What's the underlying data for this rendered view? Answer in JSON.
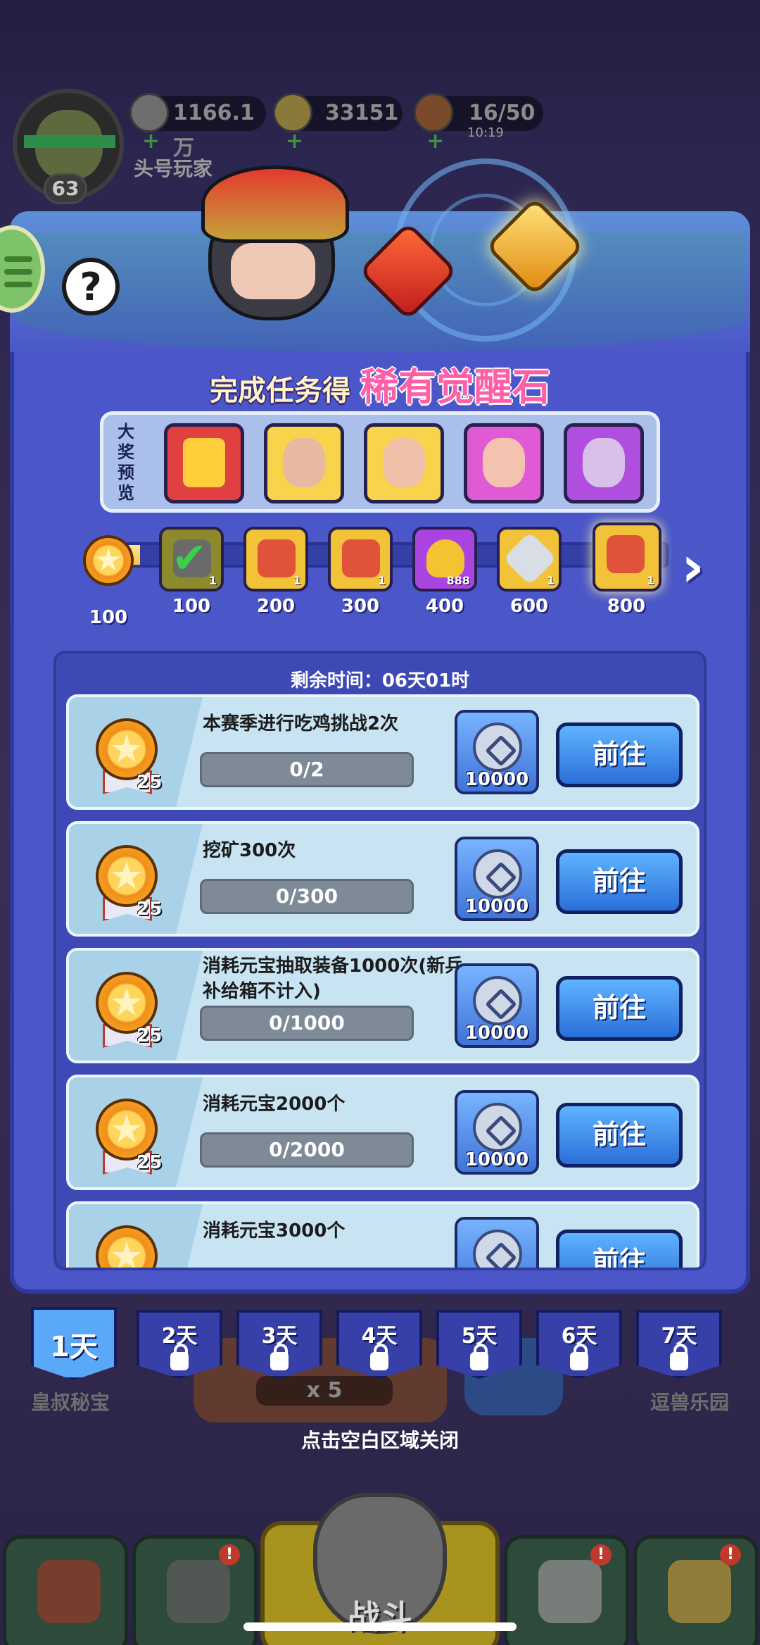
{
  "status": {
    "level": "63",
    "player_name": "头号玩家",
    "copper": "1166.1万",
    "gold": "33151",
    "stamina": "16/50",
    "stamina_timer": "10:19"
  },
  "headline": {
    "prefix": "完成任务得",
    "highlight": "稀有觉醒石"
  },
  "preview": {
    "label": "大奖预览",
    "items": [
      "red-puzzle",
      "hero-1",
      "hero-2",
      "hero-3",
      "hero-4"
    ]
  },
  "progress": {
    "current_points": "100",
    "fill_fraction": 0.08,
    "milestones": [
      {
        "points": "100",
        "count": "1",
        "claimed": true
      },
      {
        "points": "200",
        "count": "1",
        "claimed": false
      },
      {
        "points": "300",
        "count": "1",
        "claimed": false
      },
      {
        "points": "400",
        "count": "888",
        "claimed": false
      },
      {
        "points": "600",
        "count": "1",
        "claimed": false
      },
      {
        "points": "800",
        "count": "1",
        "claimed": false
      }
    ]
  },
  "tasks": {
    "remaining_time": "剩余时间：06天01时",
    "go_label": "前往",
    "items": [
      {
        "title": "本赛季进行吃鸡挑战2次",
        "progress": "0/2",
        "points": "25",
        "reward": "10000"
      },
      {
        "title": "挖矿300次",
        "progress": "0/300",
        "points": "25",
        "reward": "10000"
      },
      {
        "title": "消耗元宝抽取装备1000次(新兵补给箱不计入)",
        "progress": "0/1000",
        "points": "25",
        "reward": "10000"
      },
      {
        "title": "消耗元宝2000个",
        "progress": "0/2000",
        "points": "25",
        "reward": "10000"
      },
      {
        "title": "消耗元宝3000个",
        "progress": "",
        "points": "",
        "reward": ""
      }
    ]
  },
  "days": [
    "1天",
    "2天",
    "3天",
    "4天",
    "5天",
    "6天",
    "7天"
  ],
  "background": {
    "left_label": "皇叔秘宝",
    "right_label": "逗兽乐园",
    "mid_count": "x 5"
  },
  "close_hint": "点击空白区域关闭",
  "bottom_nav": {
    "battle_label": "战斗",
    "badge": "!"
  }
}
